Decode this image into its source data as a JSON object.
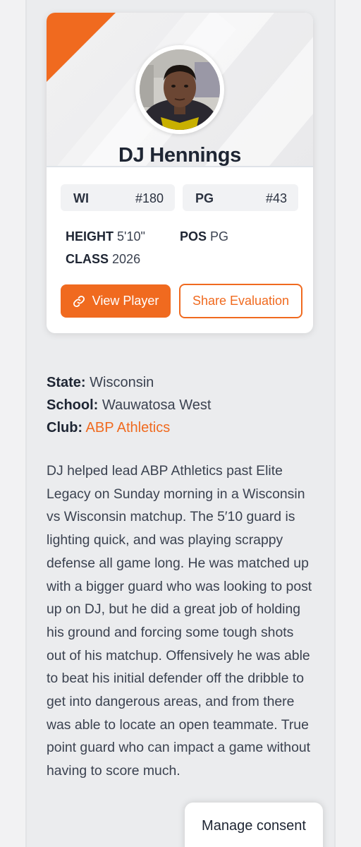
{
  "player": {
    "name": "DJ Hennings",
    "state_rank": {
      "label": "WI",
      "value": "#180"
    },
    "position_rank": {
      "label": "PG",
      "value": "#43"
    },
    "height_label": "HEIGHT",
    "height_value": "5'10\"",
    "pos_label": "POS",
    "pos_value": "PG",
    "class_label": "CLASS",
    "class_value": "2026"
  },
  "buttons": {
    "view_player": "View Player",
    "share_evaluation": "Share Evaluation"
  },
  "details": {
    "state_label": "State:",
    "state_value": "Wisconsin",
    "school_label": "School:",
    "school_value": "Wauwatosa West",
    "club_label": "Club:",
    "club_value": "ABP Athletics"
  },
  "bio": "DJ helped lead ABP Athletics past Elite Legacy on Sunday morning in a Wisconsin vs Wisconsin matchup. The 5′10 guard is lighting quick, and was playing scrappy defense all game long. He was matched up with a bigger guard who was looking to post up on DJ, but he did a great job of holding his ground and forcing some tough shots out of his matchup. Offensively he was able to beat his initial defender off the dribble to get into dangerous areas, and from there was able to locate an open teammate. True point guard who can impact a game without having to score much.",
  "consent": {
    "label": "Manage consent"
  },
  "colors": {
    "accent": "#f06a1f",
    "text_dark": "#1e2533",
    "background": "#ebecee"
  }
}
